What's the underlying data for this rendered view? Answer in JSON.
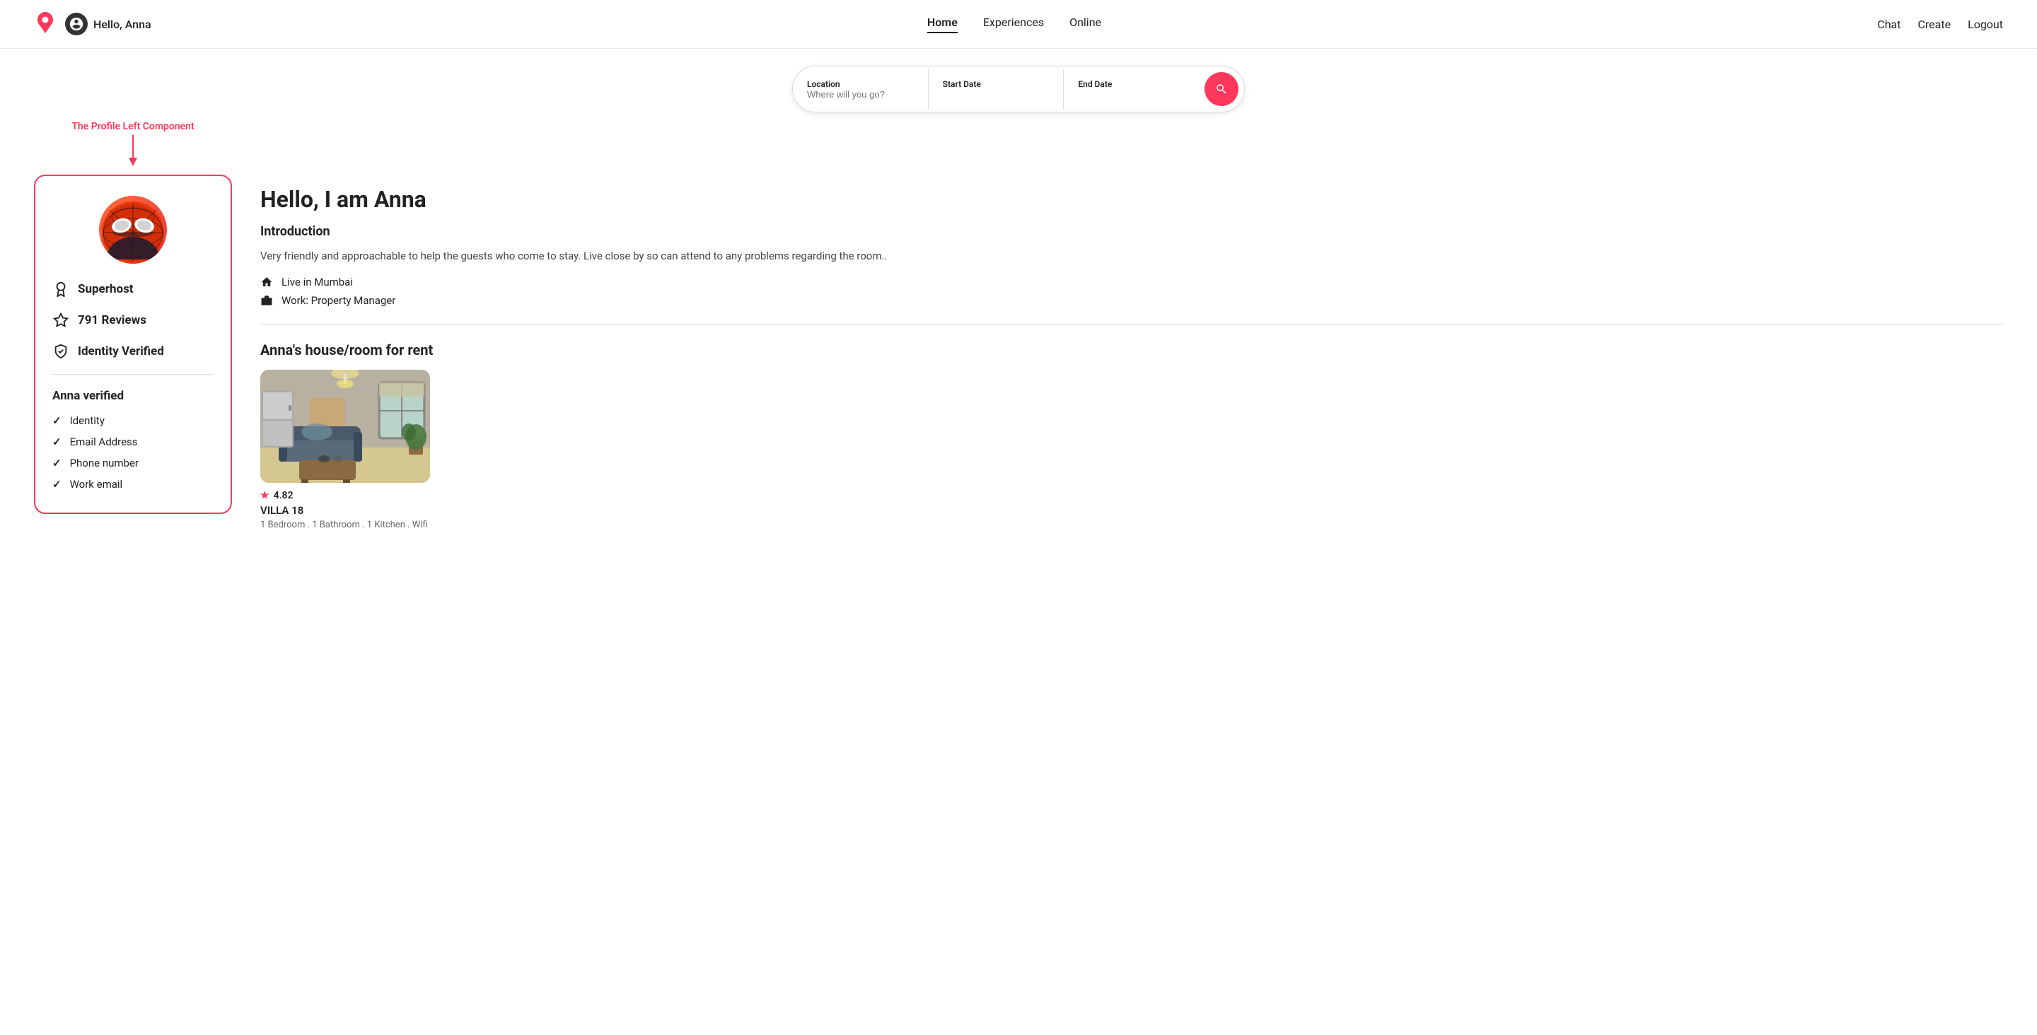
{
  "navbar": {
    "logo_alt": "Airbnb",
    "user_greeting": "Hello, Anna",
    "nav_links": [
      {
        "label": "Home",
        "active": true
      },
      {
        "label": "Experiences",
        "active": false
      },
      {
        "label": "Online",
        "active": false
      }
    ],
    "right_links": [
      {
        "label": "Chat"
      },
      {
        "label": "Create"
      },
      {
        "label": "Logout"
      }
    ]
  },
  "search": {
    "location_label": "Location",
    "location_placeholder": "Where will you go?",
    "start_date_label": "Start Date",
    "start_date_value": "",
    "end_date_label": "End Date",
    "end_date_value": ""
  },
  "annotation": {
    "text": "The Profile Left Component"
  },
  "left_panel": {
    "stats": [
      {
        "icon": "medal",
        "label": "Superhost"
      },
      {
        "icon": "star",
        "label": "791 Reviews"
      },
      {
        "icon": "shield",
        "label": "Identity Verified"
      }
    ],
    "verified_title": "Anna verified",
    "verified_items": [
      "Identity",
      "Email Address",
      "Phone number",
      "Work email"
    ]
  },
  "profile": {
    "greeting": "Hello, I am Anna",
    "intro_title": "Introduction",
    "intro_text": "Very friendly and approachable to help the guests who come to stay. Live close by so can attend to any problems regarding the room..",
    "location": "Live in Mumbai",
    "work": "Work: Property Manager"
  },
  "listings": {
    "section_title": "Anna's house/room for rent",
    "cards": [
      {
        "rating": "4.82",
        "name": "VILLA 18",
        "features": "1 Bedroom . 1 Bathroom . 1 Kitchen . Wifi"
      }
    ]
  }
}
